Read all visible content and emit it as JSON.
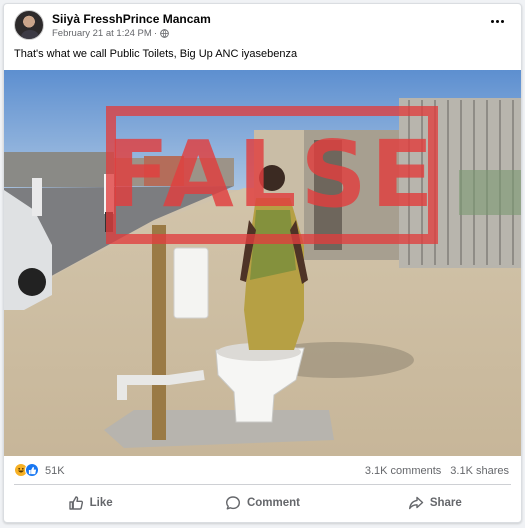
{
  "post": {
    "author": "Siiyà FresshPrince Mancam",
    "date": "February 21 at 1:24 PM",
    "visibility_icon": "globe-icon",
    "caption": "That's what we call Public Toilets, Big Up ANC iyasebenza"
  },
  "photo": {
    "overlay_label": "FALSE",
    "overlay_color": "#e03e3e"
  },
  "reactions": {
    "icons": [
      "haha-icon",
      "like-icon"
    ],
    "count": "51K",
    "comments": "3.1K comments",
    "shares": "3.1K shares"
  },
  "actions": {
    "like": "Like",
    "comment": "Comment",
    "share": "Share"
  },
  "colors": {
    "text_primary": "#050505",
    "text_secondary": "#65676b",
    "like_blue": "#1877f2"
  }
}
